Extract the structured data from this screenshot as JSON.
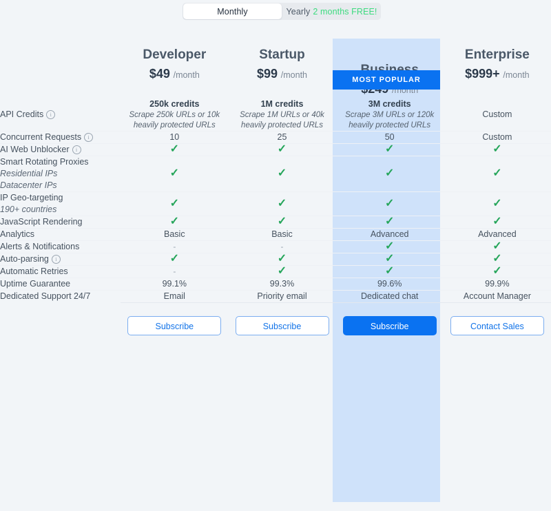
{
  "billing_toggle": {
    "monthly_label": "Monthly",
    "yearly_label": "Yearly",
    "yearly_promo": "2 months FREE!",
    "selected": "Monthly"
  },
  "popular_badge": "MOST POPULAR",
  "colors": {
    "page_background": "#f2f5f8",
    "accent_blue": "#0a72f1",
    "popular_column": "#cfe2fa",
    "check_green": "#25a55a",
    "promo_green": "#3ddb7f"
  },
  "plans": [
    {
      "name": "Developer",
      "price": "$49",
      "period": "/month",
      "popular": false,
      "cta": "Subscribe"
    },
    {
      "name": "Startup",
      "price": "$99",
      "period": "/month",
      "popular": false,
      "cta": "Subscribe"
    },
    {
      "name": "Business",
      "price": "$249",
      "period": "/month",
      "popular": true,
      "cta": "Subscribe"
    },
    {
      "name": "Enterprise",
      "price": "$999+",
      "period": "/month",
      "popular": false,
      "cta": "Contact Sales"
    }
  ],
  "features": [
    {
      "label": "API Credits",
      "sub": "",
      "info": true,
      "values": [
        {
          "big": "250k credits",
          "note": "Scrape 250k URLs or 10k heavily protected URLs"
        },
        {
          "big": "1M credits",
          "note": "Scrape 1M URLs or 40k heavily protected URLs"
        },
        {
          "big": "3M credits",
          "note": "Scrape 3M URLs or 120k heavily protected URLs"
        },
        {
          "big": "",
          "note": "",
          "text": "Custom"
        }
      ]
    },
    {
      "label": "Concurrent Requests",
      "sub": "",
      "info": true,
      "values": [
        {
          "text": "10"
        },
        {
          "text": "25"
        },
        {
          "text": "50"
        },
        {
          "text": "Custom"
        }
      ]
    },
    {
      "label": "AI Web Unblocker",
      "sub": "",
      "info": true,
      "values": [
        {
          "check": true
        },
        {
          "check": true
        },
        {
          "check": true
        },
        {
          "check": true
        }
      ]
    },
    {
      "label": "Smart Rotating Proxies",
      "sub": "Residential IPs\nDatacenter IPs",
      "info": false,
      "values": [
        {
          "check": true
        },
        {
          "check": true
        },
        {
          "check": true
        },
        {
          "check": true
        }
      ]
    },
    {
      "label": "IP Geo-targeting",
      "sub": "190+ countries",
      "info": false,
      "values": [
        {
          "check": true
        },
        {
          "check": true
        },
        {
          "check": true
        },
        {
          "check": true
        }
      ]
    },
    {
      "label": "JavaScript Rendering",
      "sub": "",
      "info": false,
      "values": [
        {
          "check": true
        },
        {
          "check": true
        },
        {
          "check": true
        },
        {
          "check": true
        }
      ]
    },
    {
      "label": "Analytics",
      "sub": "",
      "info": false,
      "values": [
        {
          "text": "Basic"
        },
        {
          "text": "Basic"
        },
        {
          "text": "Advanced"
        },
        {
          "text": "Advanced"
        }
      ]
    },
    {
      "label": "Alerts & Notifications",
      "sub": "",
      "info": false,
      "values": [
        {
          "dash": true
        },
        {
          "dash": true
        },
        {
          "check": true
        },
        {
          "check": true
        }
      ]
    },
    {
      "label": "Auto-parsing",
      "sub": "",
      "info": true,
      "values": [
        {
          "check": true
        },
        {
          "check": true
        },
        {
          "check": true
        },
        {
          "check": true
        }
      ]
    },
    {
      "label": "Automatic Retries",
      "sub": "",
      "info": false,
      "values": [
        {
          "dash": true
        },
        {
          "check": true
        },
        {
          "check": true
        },
        {
          "check": true
        }
      ]
    },
    {
      "label": "Uptime Guarantee",
      "sub": "",
      "info": false,
      "values": [
        {
          "text": "99.1%"
        },
        {
          "text": "99.3%"
        },
        {
          "text": "99.6%"
        },
        {
          "text": "99.9%"
        }
      ]
    },
    {
      "label": "Dedicated Support 24/7",
      "sub": "",
      "info": false,
      "values": [
        {
          "text": "Email"
        },
        {
          "text": "Priority email"
        },
        {
          "text": "Dedicated chat"
        },
        {
          "text": "Account Manager"
        }
      ]
    }
  ]
}
